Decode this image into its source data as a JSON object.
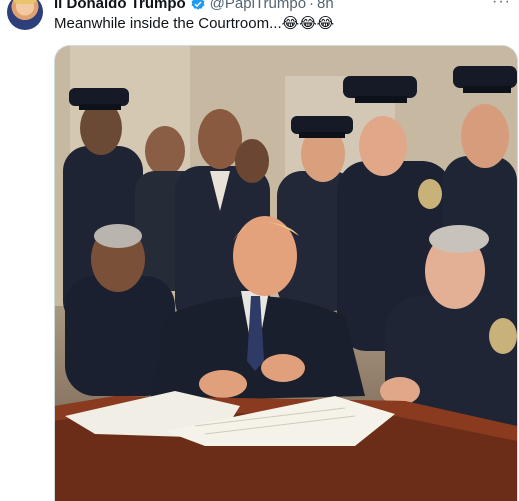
{
  "tweet": {
    "display_name": "il Donaldo Trumpo",
    "handle": "@PapiTrumpo",
    "separator": "·",
    "time": "8h",
    "text": "Meanwhile inside the Courtroom...😂😂😂",
    "more_label": "···"
  },
  "icons": {
    "verified": "verified-badge-icon",
    "more": "more-options-icon"
  },
  "colors": {
    "verified_blue": "#1d9bf0",
    "secondary_text": "#536471",
    "uniform_navy": "#1e2433",
    "table_wood": "#6b2d18"
  }
}
